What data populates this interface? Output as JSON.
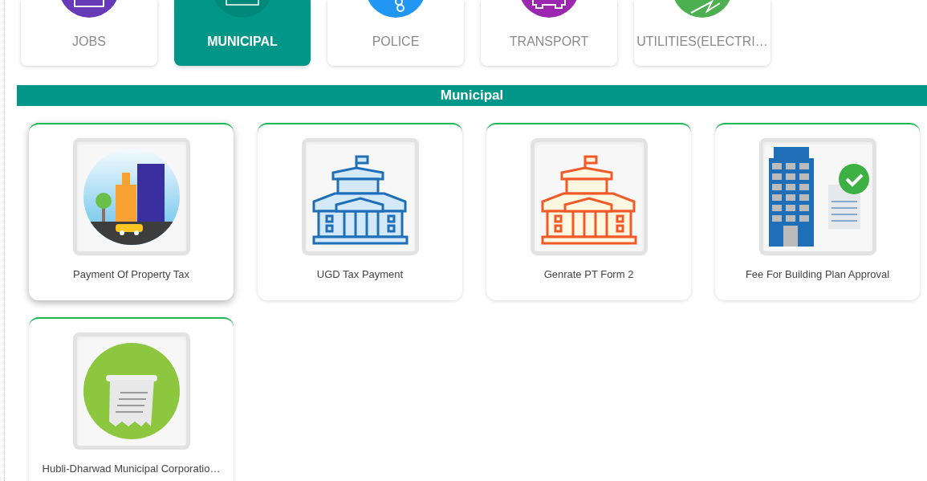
{
  "categories": [
    {
      "label": "JOBS",
      "kind": "jobs",
      "selected": false
    },
    {
      "label": "MUNICIPAL",
      "kind": "municipal",
      "selected": true
    },
    {
      "label": "POLICE",
      "kind": "police",
      "selected": false
    },
    {
      "label": "TRANSPORT",
      "kind": "transport",
      "selected": false
    },
    {
      "label": "UTILITIES(ELECTRI…",
      "kind": "utilities",
      "selected": false
    }
  ],
  "section": {
    "title": "Municipal"
  },
  "services": [
    {
      "label": "Payment Of Property Tax",
      "kind": "city",
      "hovered": true
    },
    {
      "label": "UGD Tax Payment",
      "kind": "blue-building",
      "hovered": false
    },
    {
      "label": "Genrate PT Form 2",
      "kind": "orange-building",
      "hovered": false
    },
    {
      "label": "Fee For Building Plan Approval",
      "kind": "fee-building",
      "hovered": false
    },
    {
      "label": "Hubli-Dharwad Municipal Corporatio…",
      "kind": "receipt",
      "hovered": false
    }
  ]
}
